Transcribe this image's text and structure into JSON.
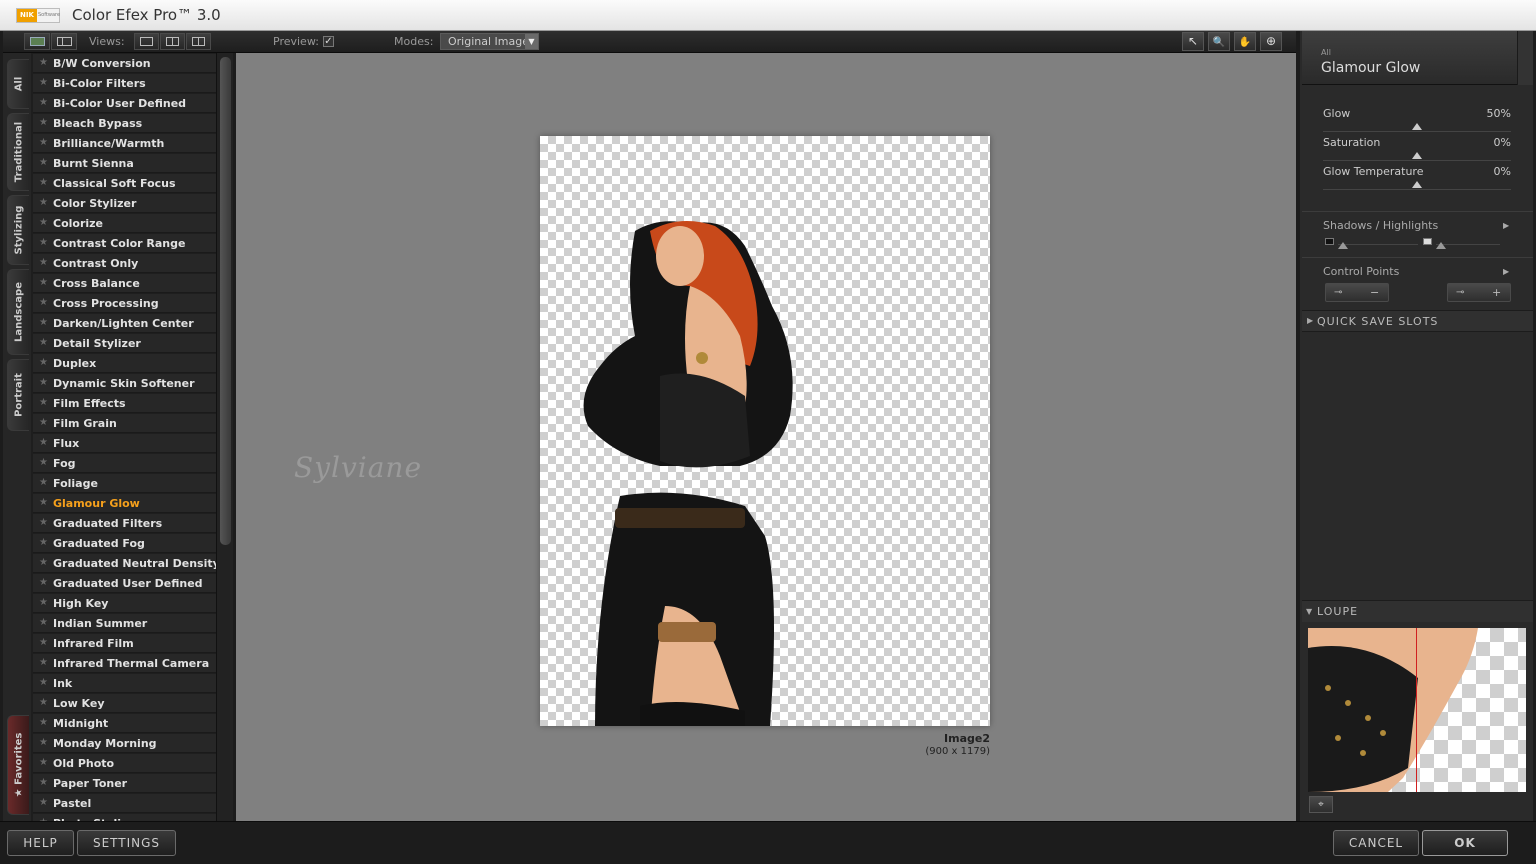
{
  "window": {
    "title": "Color Efex Pro™ 3.0",
    "logo_text": "NIK",
    "logo_sub": "Software"
  },
  "toolbar": {
    "views_label": "Views:",
    "preview_label": "Preview:",
    "preview_checked": "✓",
    "modes_label": "Modes:",
    "modes_value": "Original Image",
    "modes_arrow": "▼",
    "tools": {
      "pointer": "↖",
      "zoom": "🔍",
      "hand": "✋",
      "control_point": "⊕"
    }
  },
  "side_tabs": [
    "All",
    "Traditional",
    "Stylizing",
    "Landscape",
    "Portrait",
    "★ Favorites"
  ],
  "filters": [
    "B/W Conversion",
    "Bi-Color Filters",
    "Bi-Color User Defined",
    "Bleach Bypass",
    "Brilliance/Warmth",
    "Burnt Sienna",
    "Classical Soft Focus",
    "Color Stylizer",
    "Colorize",
    "Contrast Color Range",
    "Contrast Only",
    "Cross Balance",
    "Cross Processing",
    "Darken/Lighten Center",
    "Detail Stylizer",
    "Duplex",
    "Dynamic Skin Softener",
    "Film Effects",
    "Film Grain",
    "Flux",
    "Fog",
    "Foliage",
    "Glamour Glow",
    "Graduated Filters",
    "Graduated Fog",
    "Graduated Neutral Density",
    "Graduated User Defined",
    "High Key",
    "Indian Summer",
    "Infrared Film",
    "Infrared Thermal Camera",
    "Ink",
    "Low Key",
    "Midnight",
    "Monday Morning",
    "Old Photo",
    "Paper Toner",
    "Pastel",
    "Photo Stylizer"
  ],
  "selected_filter": "Glamour Glow",
  "star_glyph": "★",
  "canvas": {
    "image_name": "Image2",
    "image_size": "(900 x 1179)",
    "watermark": "Sylviane"
  },
  "panel": {
    "category": "All",
    "title": "Glamour Glow",
    "sliders": [
      {
        "label": "Glow",
        "value": "50%",
        "level": 0.5
      },
      {
        "label": "Saturation",
        "value": "0%",
        "level": 0.5
      },
      {
        "label": "Glow Temperature",
        "value": "0%",
        "level": 0.5
      }
    ],
    "shadows_highlights": "Shadows / Highlights",
    "control_points": "Control Points",
    "cp_minus": "−",
    "cp_plus": "+",
    "quick_save": "QUICK SAVE SLOTS",
    "loupe": "LOUPE",
    "pin": "⌖"
  },
  "buttons": {
    "help": "HELP",
    "settings": "SETTINGS",
    "cancel": "CANCEL",
    "ok": "OK"
  },
  "colors": {
    "selected": "#f5a01c",
    "hair": "#c8491a",
    "dress": "#141414",
    "skin": "#e8b48e"
  }
}
